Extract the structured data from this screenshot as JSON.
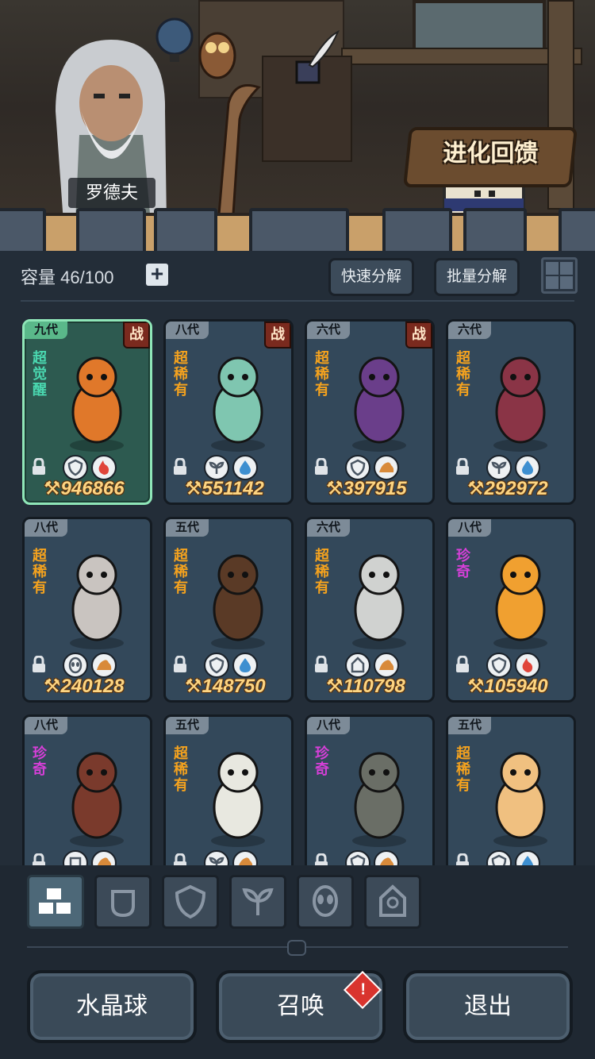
{
  "header": {
    "npc_name": "罗德夫",
    "evolution_feedback_label": "进化回馈"
  },
  "toolbar": {
    "capacity_label": "容量",
    "capacity_value": "46/100",
    "add_symbol": "+",
    "quick_decompose_label": "快速分解",
    "batch_decompose_label": "批量分解"
  },
  "cards": [
    {
      "generation": "九代",
      "rarity": "超觉醒",
      "rarity_color": "teal",
      "in_battle": true,
      "battle_label": "战",
      "power": "946866",
      "icons": [
        "shield-icon",
        "fire-icon"
      ],
      "special": true
    },
    {
      "generation": "八代",
      "rarity": "超稀有",
      "rarity_color": "orange",
      "in_battle": true,
      "battle_label": "战",
      "power": "551142",
      "icons": [
        "leaf-icon",
        "water-icon"
      ],
      "special": false
    },
    {
      "generation": "六代",
      "rarity": "超稀有",
      "rarity_color": "orange",
      "in_battle": true,
      "battle_label": "战",
      "power": "397915",
      "icons": [
        "shield-icon",
        "earth-icon"
      ],
      "special": false
    },
    {
      "generation": "六代",
      "rarity": "超稀有",
      "rarity_color": "orange",
      "in_battle": false,
      "battle_label": "",
      "power": "292972",
      "icons": [
        "leaf-icon",
        "water-icon"
      ],
      "special": false
    },
    {
      "generation": "八代",
      "rarity": "超稀有",
      "rarity_color": "orange",
      "in_battle": false,
      "battle_label": "",
      "power": "240128",
      "icons": [
        "alien-icon",
        "earth-icon"
      ],
      "special": false
    },
    {
      "generation": "五代",
      "rarity": "超稀有",
      "rarity_color": "orange",
      "in_battle": false,
      "battle_label": "",
      "power": "148750",
      "icons": [
        "shield-icon",
        "water-icon"
      ],
      "special": false
    },
    {
      "generation": "六代",
      "rarity": "超稀有",
      "rarity_color": "orange",
      "in_battle": false,
      "battle_label": "",
      "power": "110798",
      "icons": [
        "tower-icon",
        "earth-icon"
      ],
      "special": false
    },
    {
      "generation": "八代",
      "rarity": "珍奇",
      "rarity_color": "purple",
      "in_battle": false,
      "battle_label": "",
      "power": "105940",
      "icons": [
        "shield-icon",
        "fire-icon"
      ],
      "special": false
    },
    {
      "generation": "八代",
      "rarity": "珍奇",
      "rarity_color": "purple",
      "in_battle": false,
      "battle_label": "",
      "power": "",
      "icons": [
        "fist-icon",
        "earth-icon"
      ],
      "special": false
    },
    {
      "generation": "五代",
      "rarity": "超稀有",
      "rarity_color": "orange",
      "in_battle": false,
      "battle_label": "",
      "power": "",
      "icons": [
        "leaf-icon",
        "earth-icon"
      ],
      "special": false
    },
    {
      "generation": "八代",
      "rarity": "珍奇",
      "rarity_color": "purple",
      "in_battle": false,
      "battle_label": "",
      "power": "",
      "icons": [
        "shield-icon",
        "earth-icon"
      ],
      "special": false
    },
    {
      "generation": "五代",
      "rarity": "超稀有",
      "rarity_color": "orange",
      "in_battle": false,
      "battle_label": "",
      "power": "",
      "icons": [
        "shield-icon",
        "water-icon"
      ],
      "special": false
    }
  ],
  "filter_tabs": [
    "all-icon",
    "fist-icon",
    "shield-icon",
    "leaf-icon",
    "alien-icon",
    "tower-icon"
  ],
  "bottom_bar": {
    "crystal_ball_label": "水晶球",
    "summon_label": "召唤",
    "summon_alert": "!",
    "exit_label": "退出"
  },
  "colors": {
    "power_text": "#fdd582",
    "rarity_orange": "#f4a21e",
    "rarity_purple": "#d63fd8",
    "rarity_teal": "#4ad8b0"
  }
}
